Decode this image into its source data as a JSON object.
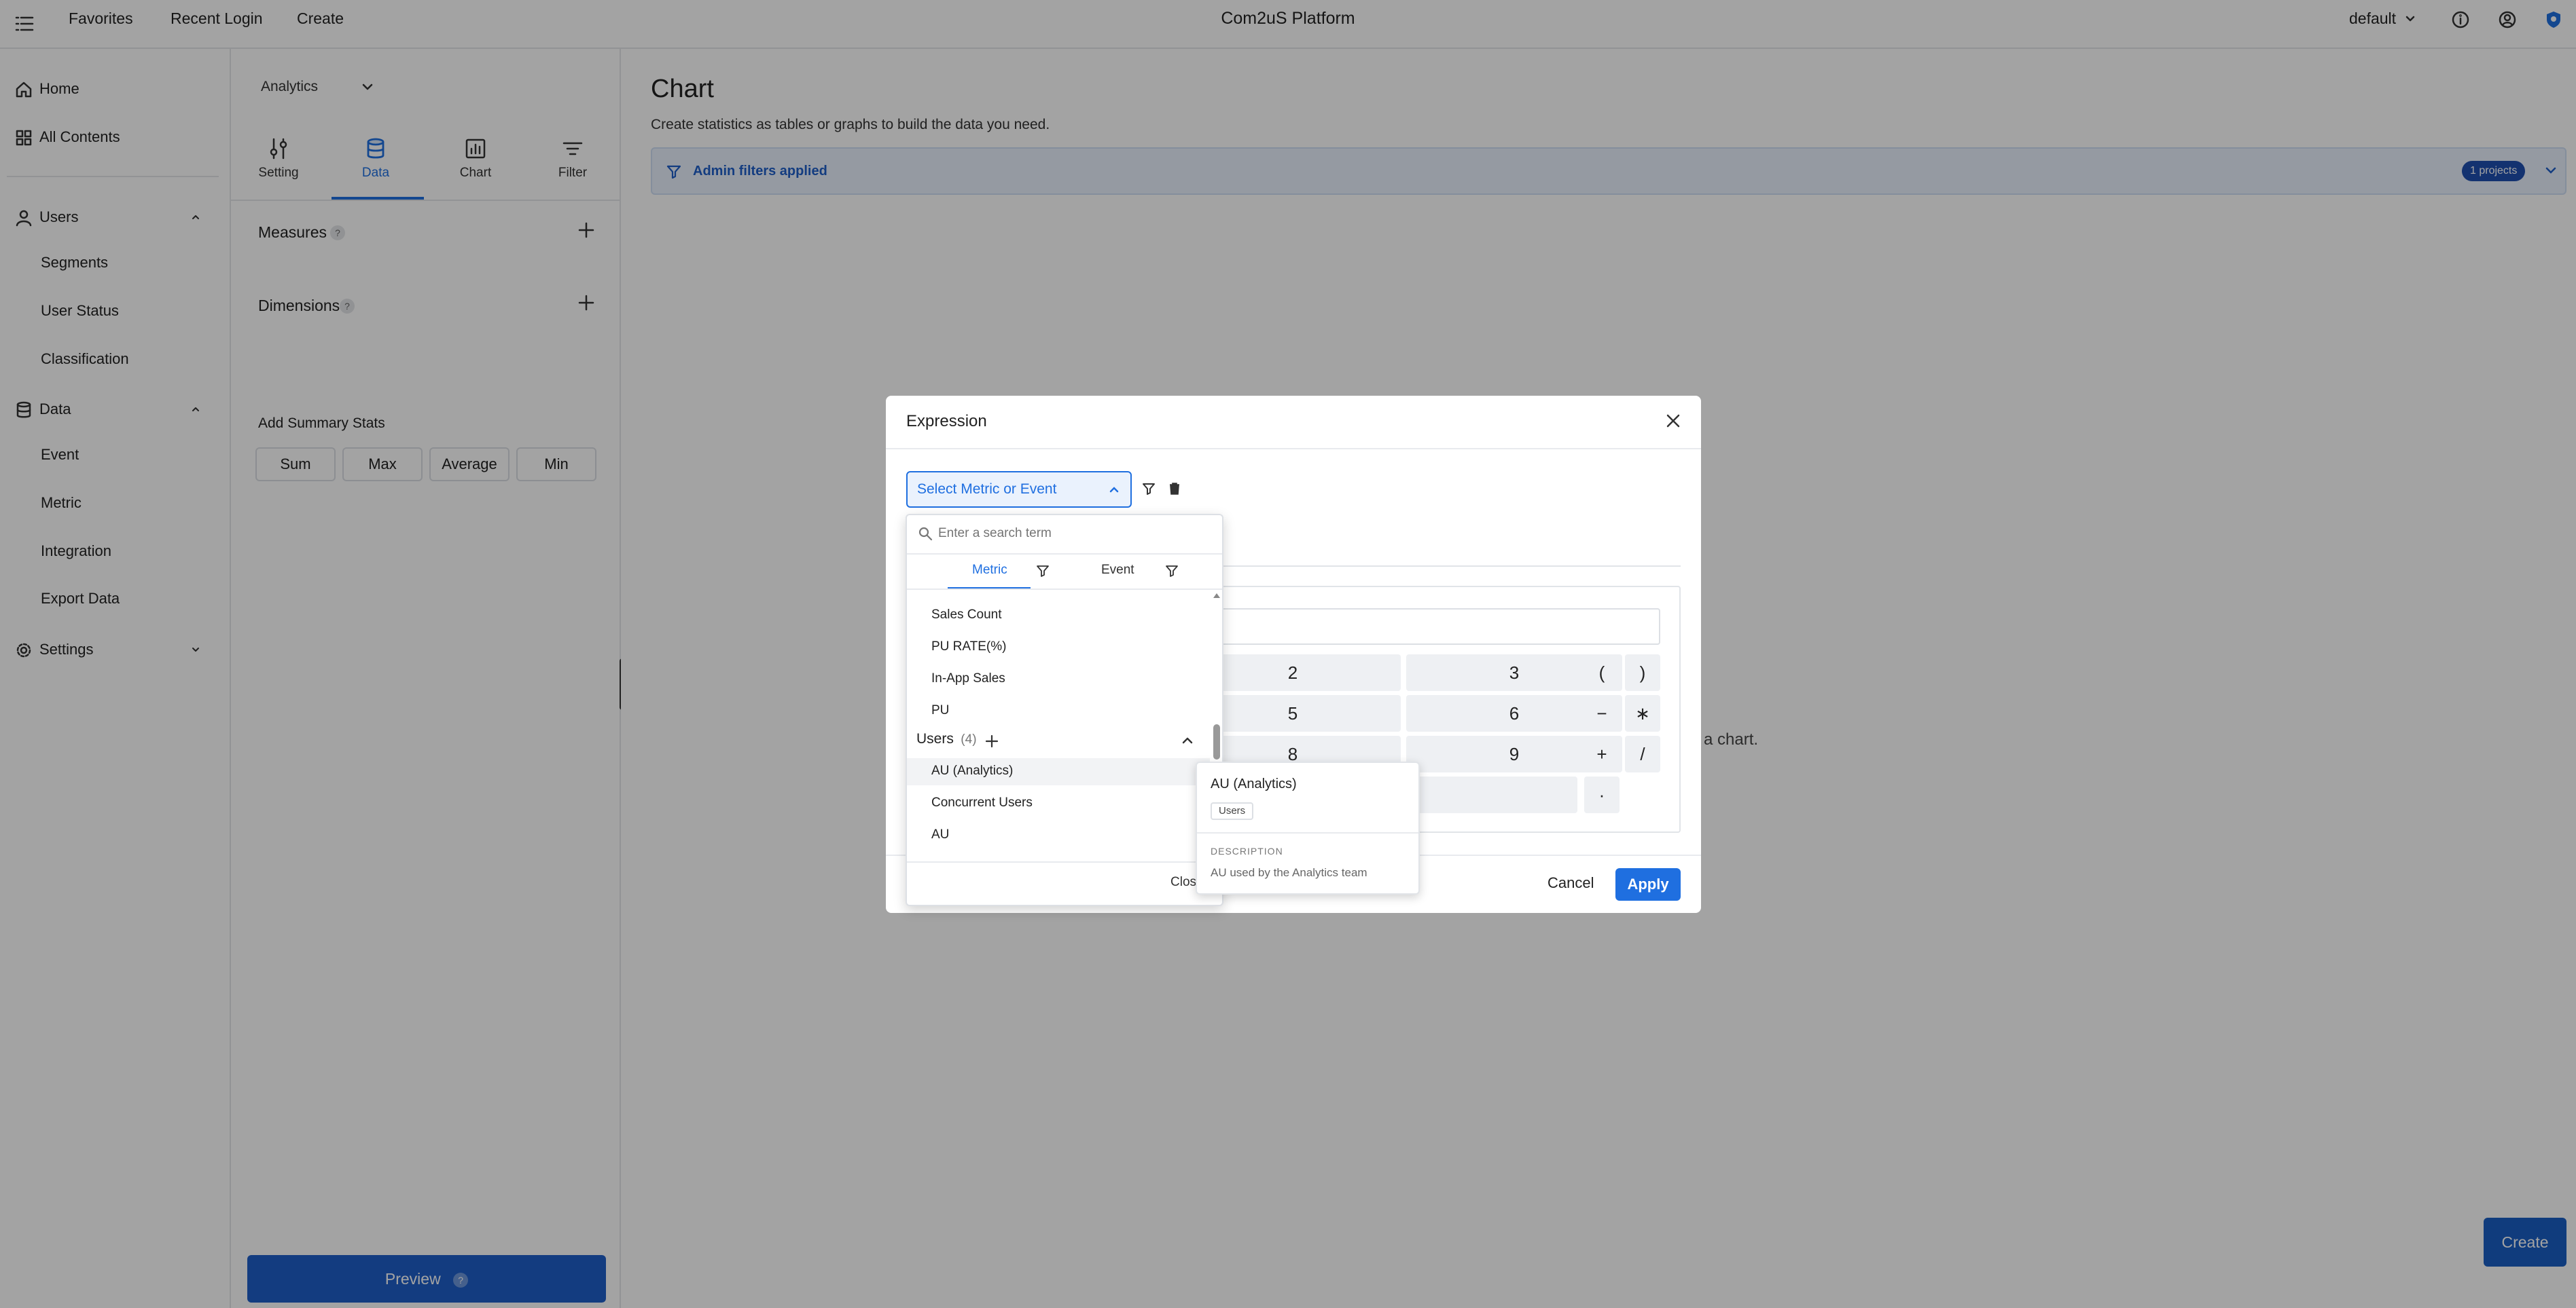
{
  "topbar": {
    "favorites": "Favorites",
    "recent_login": "Recent Login",
    "create": "Create",
    "brand": "Com2uS Platform",
    "workspace": "default"
  },
  "leftnav": {
    "home": "Home",
    "all_contents": "All Contents",
    "users": "Users",
    "users_items": [
      "Segments",
      "User Status",
      "Classification"
    ],
    "data": "Data",
    "data_items": [
      "Event",
      "Metric",
      "Integration",
      "Export Data"
    ],
    "settings": "Settings"
  },
  "panel": {
    "source": "Analytics",
    "tabs": [
      "Setting",
      "Data",
      "Chart",
      "Filter"
    ],
    "active_tab": "Data",
    "measures": "Measures",
    "dimensions": "Dimensions",
    "help_glyph": "?",
    "summary_title": "Add Summary Stats",
    "summary_buttons": [
      "Sum",
      "Max",
      "Average",
      "Min"
    ],
    "preview": "Preview"
  },
  "main": {
    "title": "Chart",
    "subtitle": "Create statistics as tables or graphs to build the data you need.",
    "admin_filters": "Admin filters applied",
    "projects_badge": "1 projects",
    "empty_text_tail": "e a chart.",
    "create_button": "Create"
  },
  "modal": {
    "title": "Expression",
    "select_placeholder": "Select Metric or Event",
    "keys": [
      "2",
      "3",
      "(",
      ")",
      "5",
      "6",
      "−",
      "∗",
      "8",
      "9",
      "+",
      "/",
      "·"
    ],
    "cancel": "Cancel",
    "apply": "Apply"
  },
  "dropdown": {
    "search_placeholder": "Enter a search term",
    "tabs": [
      "Metric",
      "Event"
    ],
    "active_tab": "Metric",
    "items_top": [
      "Sales Count",
      "PU RATE(%)",
      "In-App Sales",
      "PU"
    ],
    "group_label": "Users",
    "group_count": "(4)",
    "group_items": [
      "AU (Analytics)",
      "Concurrent Users",
      "AU"
    ],
    "highlighted_item": "AU (Analytics)",
    "close": "Close"
  },
  "tooltip": {
    "title": "AU (Analytics)",
    "tag": "Users",
    "desc_label": "DESCRIPTION",
    "desc": "AU used by the Analytics team"
  },
  "colors": {
    "accent": "#1f6fe0",
    "banner_bg": "#e9f1fd",
    "banner_text": "#1f5fc8",
    "badge_bg": "#1f4fb0",
    "preview_bg": "#1f5fc8",
    "create_bg": "#1a5fc4",
    "overlay": "rgba(0,0,0,0.36)"
  },
  "icons": {
    "menu": "menu-icon",
    "info": "info-icon",
    "account": "account-icon",
    "shield": "shield-icon",
    "home": "home-icon",
    "grid": "grid-icon",
    "user": "user-icon",
    "database": "database-icon",
    "gear": "gear-icon",
    "sliders": "sliders-icon",
    "chart": "chart-icon",
    "filter": "filter-icon",
    "search": "search-icon",
    "close": "close-icon",
    "trash": "trash-icon",
    "plus": "plus-icon"
  }
}
